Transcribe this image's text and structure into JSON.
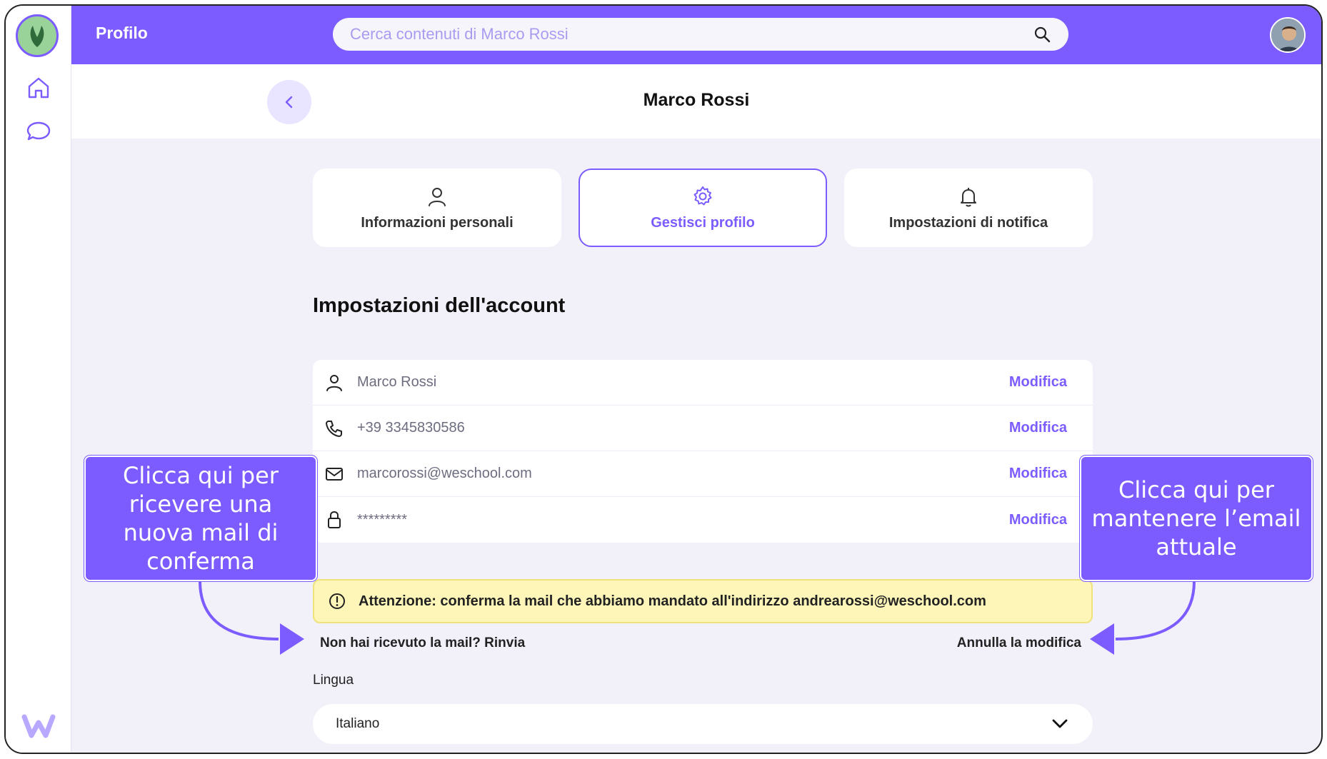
{
  "colors": {
    "accent": "#7c5cff",
    "warning_bg": "#fdf6b8",
    "page_bg": "#f2f1fa"
  },
  "topbar": {
    "title": "Profilo",
    "search_placeholder": "Cerca contenuti di Marco Rossi"
  },
  "header": {
    "title": "Marco Rossi"
  },
  "tabs": [
    {
      "label": "Informazioni personali",
      "icon": "user-icon",
      "active": false
    },
    {
      "label": "Gestisci profilo",
      "icon": "gear-icon",
      "active": true
    },
    {
      "label": "Impostazioni di notifica",
      "icon": "bell-icon",
      "active": false
    }
  ],
  "section_title": "Impostazioni dell'account",
  "settings": [
    {
      "icon": "user-icon",
      "value": "Marco Rossi",
      "action": "Modifica"
    },
    {
      "icon": "phone-icon",
      "value": "+39 3345830586",
      "action": "Modifica"
    },
    {
      "icon": "mail-icon",
      "value": "marcorossi@weschool.com",
      "action": "Modifica"
    },
    {
      "icon": "lock-icon",
      "value": "*********",
      "action": "Modifica"
    }
  ],
  "warning": {
    "icon": "alert-circle-icon",
    "text": "Attenzione: conferma la mail che abbiamo mandato all'indirizzo andrearossi@weschool.com"
  },
  "resend_link": "Non hai ricevuto la mail? Rinvia",
  "cancel_link": "Annulla la modifica",
  "language": {
    "label": "Lingua",
    "selected": "Italiano"
  },
  "callouts": {
    "left": "Clicca qui per ricevere una nuova mail di conferma",
    "right": "Clicca qui per mantenere l’email attuale"
  }
}
